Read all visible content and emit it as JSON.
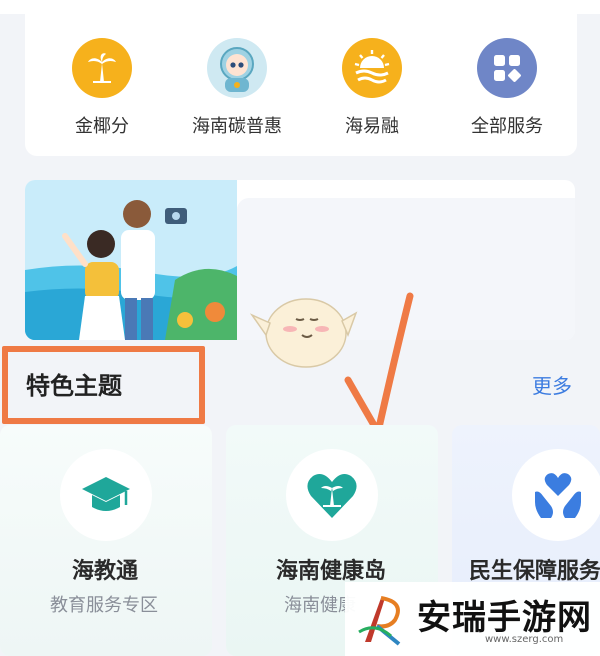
{
  "services": [
    {
      "label": "金椰分",
      "icon": "palm-tree-icon",
      "color": "#f6b11c"
    },
    {
      "label": "海南碳普惠",
      "icon": "astronaut-icon",
      "color": "#4aa9c9"
    },
    {
      "label": "海易融",
      "icon": "sun-waves-icon",
      "color": "#f6b11c"
    },
    {
      "label": "全部服务",
      "icon": "grid-apps-icon",
      "color": "#5a73b8"
    }
  ],
  "section": {
    "title": "特色主题",
    "more": "更多"
  },
  "themes": [
    {
      "title": "海教通",
      "subtitle": "教育服务专区",
      "icon": "graduation-cap-icon",
      "color": "#1fa79a"
    },
    {
      "title": "海南健康岛",
      "subtitle": "海南健康",
      "icon": "heart-palm-icon",
      "color": "#1fa79a"
    },
    {
      "title": "民生保障服务",
      "subtitle": "",
      "icon": "hands-heart-icon",
      "color": "#3b7de0"
    }
  ],
  "watermark": {
    "text": "安瑞手游网",
    "url": "www.szerg.com"
  },
  "colors": {
    "accent": "#3d7ce0",
    "annotation": "#ef7a45"
  }
}
